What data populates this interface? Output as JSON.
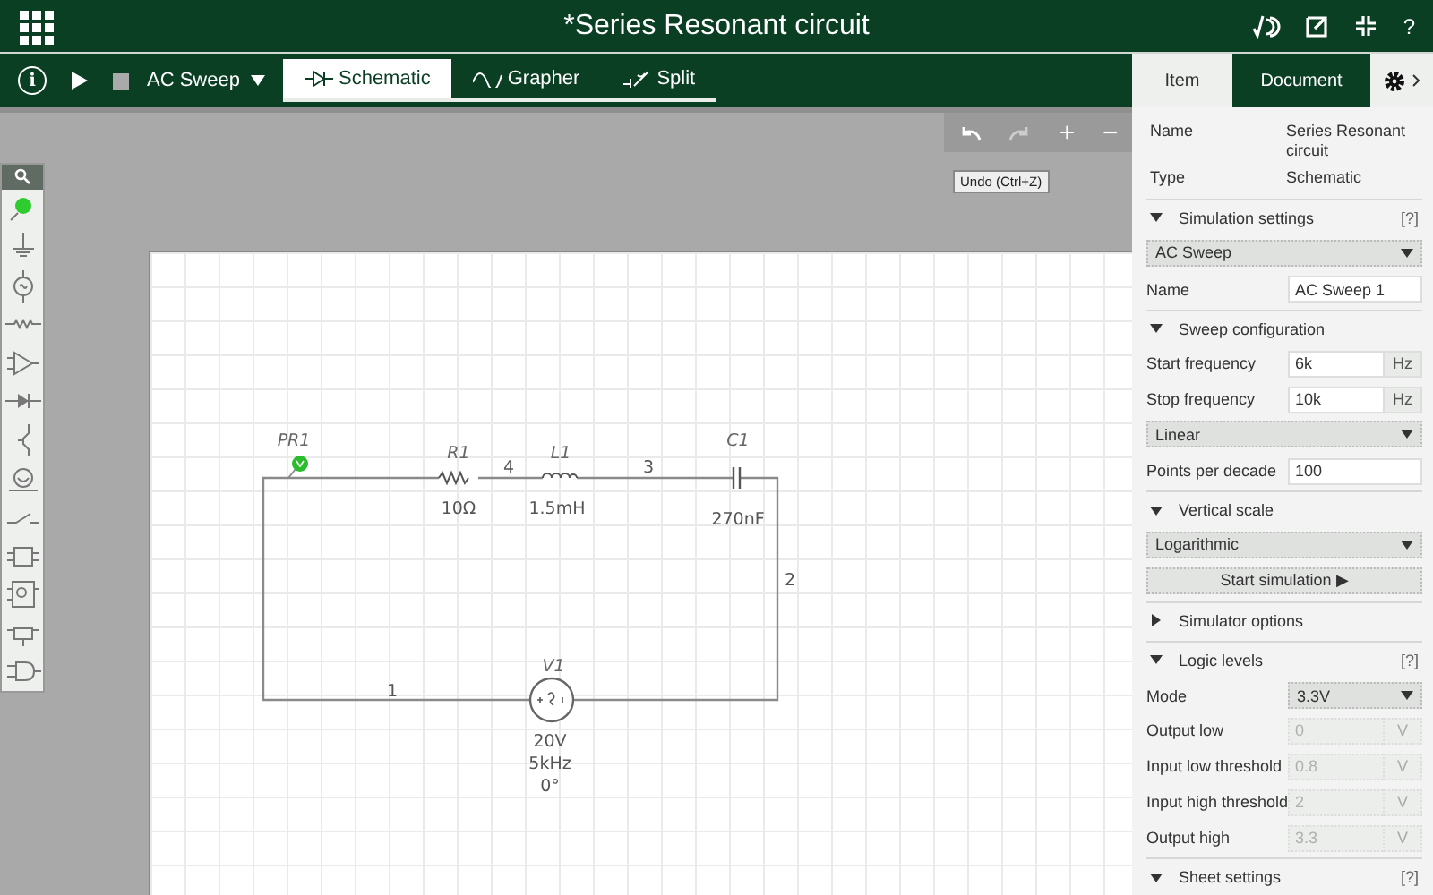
{
  "header": {
    "title": "*Series Resonant circuit",
    "help": "?"
  },
  "toolbar": {
    "info": "i",
    "analysis": "AC Sweep",
    "view_tabs": [
      {
        "label": "Schematic",
        "kind": "schematic",
        "selected": true
      },
      {
        "label": "Grapher",
        "kind": "grapher",
        "selected": false
      },
      {
        "label": "Split",
        "kind": "split",
        "selected": false
      }
    ]
  },
  "canvas": {
    "tools": [
      "+",
      "−"
    ],
    "tooltip": "Undo (Ctrl+Z)",
    "components": [
      {
        "kind": "probe",
        "label": "PR1"
      },
      {
        "kind": "resistor",
        "label": "R1",
        "values": [
          "10Ω"
        ]
      },
      {
        "kind": "inductor",
        "label": "L1",
        "values": [
          "1.5mH"
        ]
      },
      {
        "kind": "capacitor",
        "label": "C1",
        "values": [
          "270nF"
        ]
      },
      {
        "kind": "source",
        "label": "V1",
        "values": [
          "20V",
          "5kHz",
          "0°"
        ]
      }
    ],
    "nodes": [
      "4",
      "3",
      "2",
      "1"
    ]
  },
  "panel": {
    "tabs": [
      {
        "label": "Item",
        "selected": false
      },
      {
        "label": "Document",
        "selected": true
      }
    ],
    "rows": [
      {
        "kind": "prop",
        "label": "Name",
        "value": "Series Resonant circuit"
      },
      {
        "kind": "prop",
        "label": "Type",
        "value": "Schematic"
      },
      {
        "kind": "section",
        "label": "Simulation settings",
        "expanded": true,
        "help": "[?]"
      },
      {
        "kind": "select",
        "value": "AC Sweep"
      },
      {
        "kind": "field",
        "label": "Name",
        "value": "AC Sweep 1"
      },
      {
        "kind": "section",
        "label": "Sweep configuration",
        "expanded": true
      },
      {
        "kind": "unit",
        "label": "Start frequency",
        "value": "6k",
        "unit": "Hz",
        "disabled": false
      },
      {
        "kind": "unit",
        "label": "Stop frequency",
        "value": "10k",
        "unit": "Hz",
        "disabled": false
      },
      {
        "kind": "select",
        "value": "Linear"
      },
      {
        "kind": "field",
        "label": "Points per decade",
        "value": "100"
      },
      {
        "kind": "section",
        "label": "Vertical scale",
        "expanded": true
      },
      {
        "kind": "select",
        "value": "Logarithmic"
      },
      {
        "kind": "button",
        "label": "Start simulation ▶"
      },
      {
        "kind": "section",
        "label": "Simulator options",
        "expanded": false
      },
      {
        "kind": "section",
        "label": "Logic levels",
        "expanded": true,
        "help": "[?]"
      },
      {
        "kind": "labeled_select",
        "label": "Mode",
        "value": "3.3V"
      },
      {
        "kind": "unit",
        "label": "Output low",
        "value": "0",
        "unit": "V",
        "disabled": true
      },
      {
        "kind": "unit",
        "label": "Input low threshold",
        "value": "0.8",
        "unit": "V",
        "disabled": true
      },
      {
        "kind": "unit",
        "label": "Input high threshold",
        "value": "2",
        "unit": "V",
        "disabled": true
      },
      {
        "kind": "unit",
        "label": "Output high",
        "value": "3.3",
        "unit": "V",
        "disabled": true
      },
      {
        "kind": "section",
        "label": "Sheet settings",
        "expanded": true,
        "help": "[?]"
      }
    ]
  }
}
